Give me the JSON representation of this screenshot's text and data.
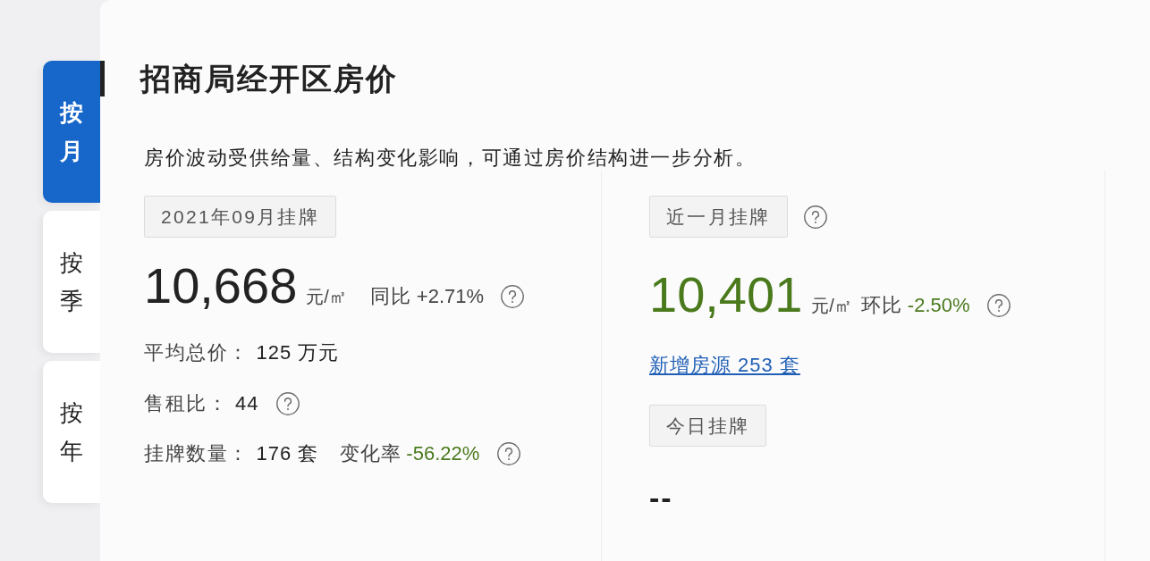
{
  "tabs": [
    {
      "label": "按月",
      "selected": true
    },
    {
      "label": "按季",
      "selected": false
    },
    {
      "label": "按年",
      "selected": false
    }
  ],
  "title": "招商局经开区房价",
  "description": "房价波动受供给量、结构变化影响，可通过房价结构进一步分析。",
  "panels": [
    {
      "kind": "monthly",
      "tag": "2021年09月挂牌",
      "tag_help": false,
      "price": "10,668",
      "unit": "元/㎡",
      "price_highlighted": false,
      "comparison": {
        "label": "同比",
        "value": "+2.71%",
        "highlighted": false,
        "help": true
      },
      "stats": [
        {
          "label": "平均总价：",
          "value": "125 万元",
          "help": false
        },
        {
          "label": "售租比：",
          "value": "44",
          "help": true
        },
        {
          "label": "挂牌数量：",
          "value": "176 套",
          "change": {
            "label": "变化率",
            "value": "-56.22%",
            "highlighted": true
          },
          "help": true
        }
      ]
    },
    {
      "kind": "recent",
      "tag": "近一月挂牌",
      "tag_help": true,
      "price": "10,401",
      "unit": "元/㎡",
      "price_highlighted": true,
      "comparison": {
        "label": "环比",
        "value": "-2.50%",
        "highlighted": true,
        "help": true
      },
      "link": "新增房源 253 套",
      "sub_tag": "今日挂牌",
      "sub_value": "--"
    }
  ]
}
